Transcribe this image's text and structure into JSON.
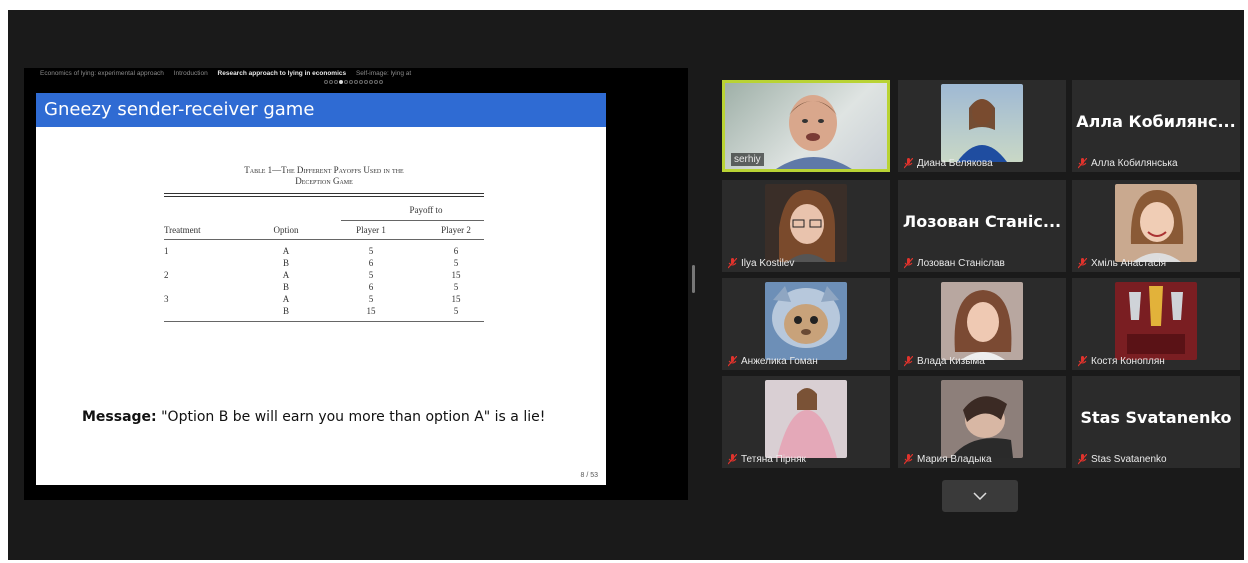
{
  "presentation": {
    "nav": [
      {
        "label": "Economics of lying: experimental approach",
        "active": false
      },
      {
        "label": "Introduction",
        "active": false
      },
      {
        "label": "Research approach to lying in economics",
        "active": true
      },
      {
        "label": "Self-image: lying at",
        "active": false
      }
    ],
    "slide_title": "Gneezy sender-receiver game",
    "table": {
      "caption_line1": "Table 1—The Different Payoffs Used in the",
      "caption_line2": "Deception Game",
      "group_header": "Payoff to",
      "headers": [
        "Treatment",
        "Option",
        "Player 1",
        "Player 2"
      ],
      "rows": [
        [
          "1",
          "A",
          "5",
          "6"
        ],
        [
          "",
          "B",
          "6",
          "5"
        ],
        [
          "2",
          "A",
          "5",
          "15"
        ],
        [
          "",
          "B",
          "6",
          "5"
        ],
        [
          "3",
          "A",
          "5",
          "15"
        ],
        [
          "",
          "B",
          "15",
          "5"
        ]
      ]
    },
    "message_label": "Message:",
    "message_text": "\"Option B be will earn you more than option A\" is a lie!",
    "page_number": "8 / 53"
  },
  "participants": [
    {
      "name": "serhiy",
      "video": true,
      "muted": false,
      "active_speaker": true
    },
    {
      "name": "Диана Белякова",
      "video": true,
      "muted": true
    },
    {
      "name": "Алла Кобилянська",
      "display": "Алла Кобилянс...",
      "video": false,
      "muted": true
    },
    {
      "name": "Ilya Kostilev",
      "video": true,
      "muted": true
    },
    {
      "name": "Лозован Станіслав",
      "display": "Лозован Станіс...",
      "video": false,
      "muted": true
    },
    {
      "name": "Хміль Анастасія",
      "video": true,
      "muted": true
    },
    {
      "name": "Анжелика Гоман",
      "video": true,
      "muted": true
    },
    {
      "name": "Влада Кизыма",
      "video": true,
      "muted": true
    },
    {
      "name": "Костя Коноплян",
      "video": true,
      "muted": true
    },
    {
      "name": "Тетяна Пірняк",
      "video": true,
      "muted": true
    },
    {
      "name": "Мария Владыка",
      "video": true,
      "muted": true
    },
    {
      "name": "Stas Svatanenko",
      "display": "Stas Svatanenko",
      "video": false,
      "muted": true
    }
  ],
  "gallery_next_icon": "chevron-down-icon",
  "colors": {
    "slide_header": "#2f6bd3",
    "active_speaker_border": "#b9d334",
    "muted_mic": "#e0332c"
  }
}
